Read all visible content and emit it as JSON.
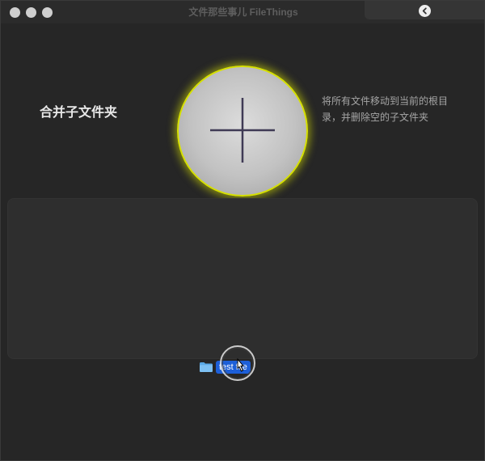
{
  "window": {
    "title": "文件那些事儿 FileThings"
  },
  "mode": {
    "label": "合并子文件夹",
    "description": "将所有文件移动到当前的根目录，并删除空的子文件夹"
  },
  "drag": {
    "filename": "test file"
  },
  "colors": {
    "accent_glow": "#d6e000",
    "selection": "#1d5fd8",
    "background": "#262626"
  },
  "icons": {
    "back": "chevron-left-icon",
    "drop": "plus-icon",
    "folder": "folder-icon",
    "cursor": "pointer-cursor-icon"
  }
}
